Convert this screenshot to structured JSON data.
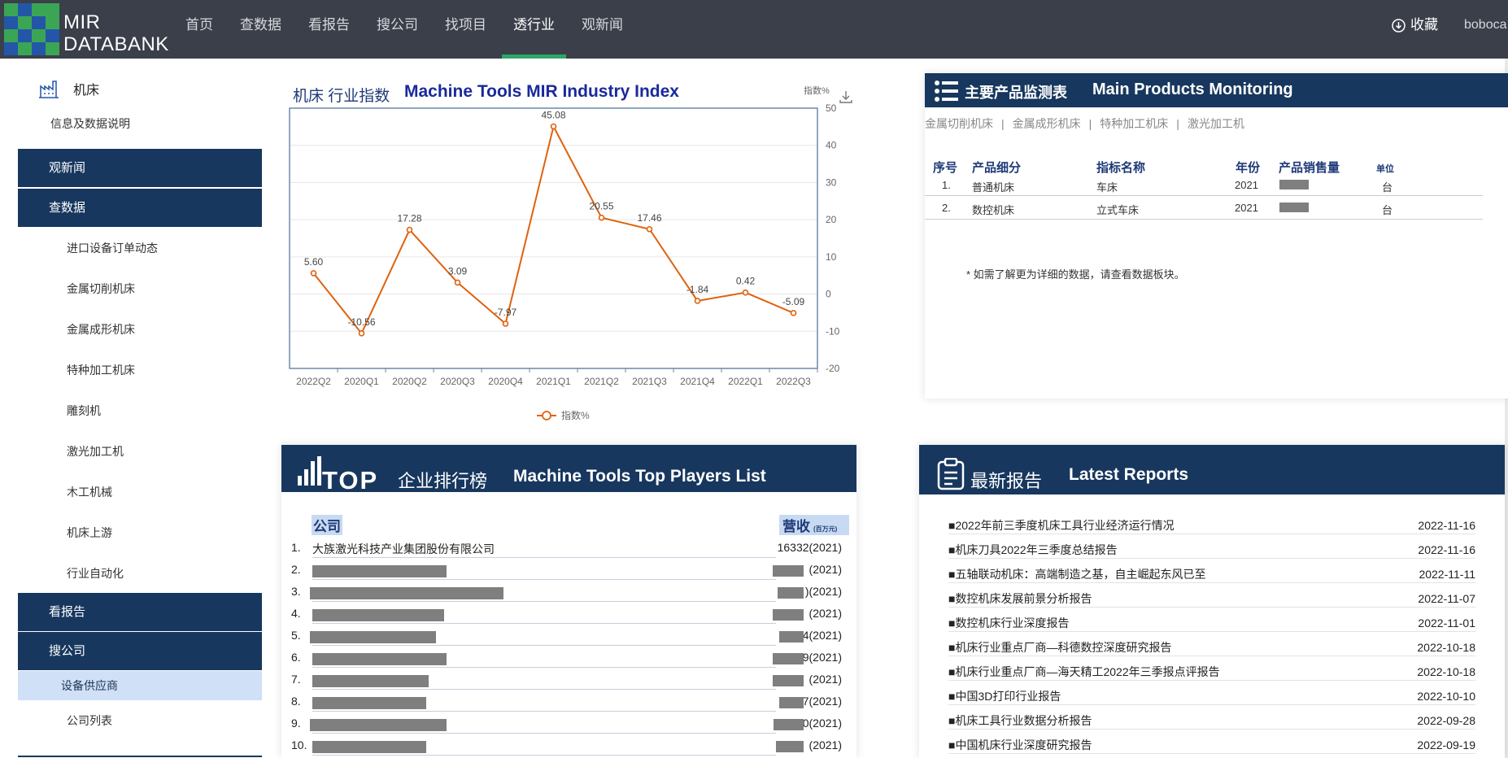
{
  "brand": {
    "line1": "MIR",
    "line2": "DATABANK"
  },
  "nav": {
    "items": [
      "首页",
      "查数据",
      "看报告",
      "搜公司",
      "找项目",
      "透行业",
      "观新闻"
    ],
    "active": "透行业",
    "favorite": "收藏",
    "user": "boboca"
  },
  "sidebar": {
    "title": "机床",
    "info": "信息及数据说明",
    "news": "观新闻",
    "data": "查数据",
    "data_items": [
      "进口设备订单动态",
      "金属切削机床",
      "金属成形机床",
      "特种加工机床",
      "雕刻机",
      "激光加工机",
      "木工机械",
      "机床上游",
      "行业自动化"
    ],
    "reports": "看报告",
    "company": "搜公司",
    "company_items": [
      "设备供应商",
      "公司列表"
    ]
  },
  "index": {
    "title_cn": "机床 行业指数",
    "title_en": "Machine Tools MIR Industry Index",
    "unit": "指数%"
  },
  "chart_data": {
    "type": "line",
    "title": "Machine Tools MIR Industry Index",
    "x": [
      "2022Q2",
      "2020Q1",
      "2020Q2",
      "2020Q3",
      "2020Q4",
      "2021Q1",
      "2021Q2",
      "2021Q3",
      "2021Q4",
      "2022Q1",
      "2022Q3"
    ],
    "series": [
      {
        "name": "指数%",
        "values": [
          5.6,
          -10.56,
          17.28,
          3.09,
          -7.97,
          45.08,
          20.55,
          17.46,
          -1.84,
          0.42,
          -5.09
        ]
      }
    ],
    "value_labels": [
      "5.60",
      "-10.56",
      "17.28",
      "3.09",
      "-7.97",
      "45.08",
      "20.55",
      "17.46",
      "-1.84",
      "0.42",
      "-5.09"
    ],
    "y_ticks": [
      "50",
      "40",
      "30",
      "20",
      "10",
      "0",
      "-10",
      "-20"
    ],
    "ylim": [
      -20,
      50
    ],
    "y_axis_side": "right",
    "legend": "bottom-center",
    "color": "#e0620e"
  },
  "products": {
    "title_cn": "主要产品监测表",
    "title_en": "Main Products Monitoring",
    "tabs": [
      "金属切削机床",
      "金属成形机床",
      "特种加工机床",
      "激光加工机"
    ],
    "tab_sep": "|",
    "headers": {
      "no": "序号",
      "segment": "产品细分",
      "indicator": "指标名称",
      "year": "年份",
      "sales": "产品销售量",
      "unit": "单位"
    },
    "rows": [
      {
        "no": "1.",
        "segment": "普通机床",
        "indicator": "车床",
        "year": "2021",
        "unit": "台"
      },
      {
        "no": "2.",
        "segment": "数控机床",
        "indicator": "立式车床",
        "year": "2021",
        "unit": "台"
      }
    ],
    "note": "* 如需了解更为详细的数据，请查看数据板块。"
  },
  "top_players": {
    "top_word": "TOP",
    "title_cn": "企业排行榜",
    "title_en": "Machine Tools Top Players List",
    "col_company": "公司",
    "col_revenue": "营收",
    "col_revenue_unit": "(百万元)",
    "rows": [
      {
        "no": "1.",
        "company": "大族激光科技产业集团股份有限公司",
        "revenue": "16332(2021)"
      },
      {
        "no": "2.",
        "company": "",
        "revenue": "(2021)"
      },
      {
        "no": "3.",
        "company": "",
        "revenue": ")(2021)"
      },
      {
        "no": "4.",
        "company": "",
        "revenue": "(2021)"
      },
      {
        "no": "5.",
        "company": "",
        "revenue": "4(2021)"
      },
      {
        "no": "6.",
        "company": "",
        "revenue": "9(2021)"
      },
      {
        "no": "7.",
        "company": "",
        "revenue": "(2021)"
      },
      {
        "no": "8.",
        "company": "",
        "revenue": "7(2021)"
      },
      {
        "no": "9.",
        "company": "",
        "revenue": "0(2021)"
      },
      {
        "no": "10.",
        "company": "",
        "revenue": "(2021)"
      }
    ]
  },
  "latest_reports": {
    "title_cn": "最新报告",
    "title_en": "Latest Reports",
    "items": [
      {
        "title": "■2022年前三季度机床工具行业经济运行情况",
        "date": "2022-11-16"
      },
      {
        "title": "■机床刀具2022年三季度总结报告",
        "date": "2022-11-16"
      },
      {
        "title": "■五轴联动机床：高端制造之基，自主崛起东风已至",
        "date": "2022-11-11"
      },
      {
        "title": "■数控机床发展前景分析报告",
        "date": "2022-11-07"
      },
      {
        "title": "■数控机床行业深度报告",
        "date": "2022-11-01"
      },
      {
        "title": "■机床行业重点厂商—科德数控深度研究报告",
        "date": "2022-10-18"
      },
      {
        "title": "■机床行业重点厂商—海天精工2022年三季报点评报告",
        "date": "2022-10-18"
      },
      {
        "title": "■中国3D打印行业报告",
        "date": "2022-10-10"
      },
      {
        "title": "■机床工具行业数据分析报告",
        "date": "2022-09-28"
      },
      {
        "title": "■中国机床行业深度研究报告",
        "date": "2022-09-19"
      }
    ]
  }
}
